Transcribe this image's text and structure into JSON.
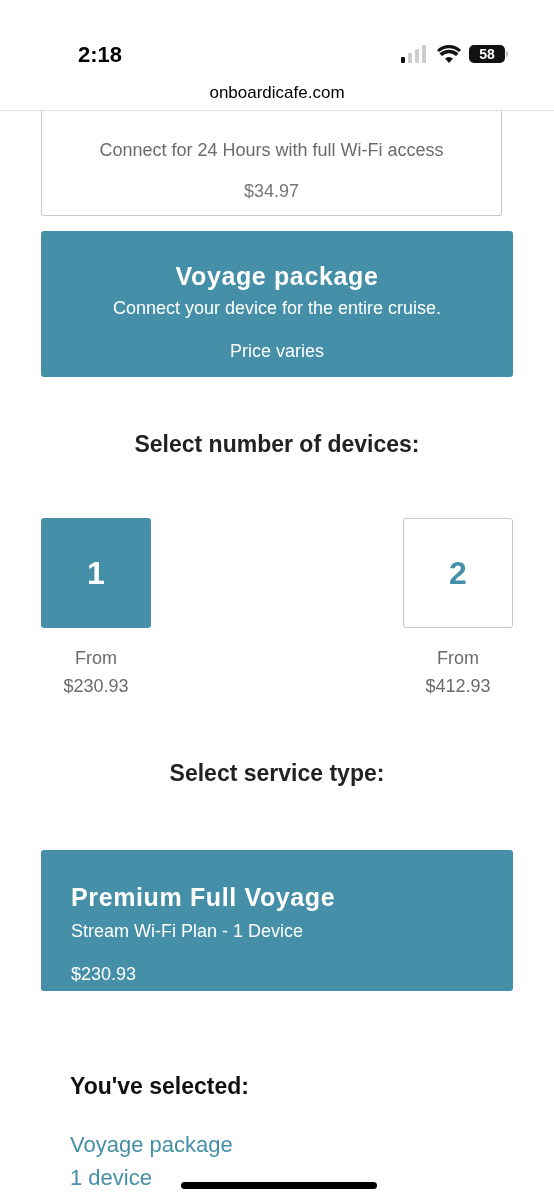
{
  "status_bar": {
    "time": "2:18",
    "battery": "58"
  },
  "address_bar": {
    "url": "onboardicafe.com"
  },
  "packages": [
    {
      "description": "Connect for 24 Hours with full Wi-Fi access",
      "price": "$34.97",
      "selected": false
    },
    {
      "title": "Voyage package",
      "description": "Connect your device for the entire cruise.",
      "price": "Price varies",
      "selected": true
    }
  ],
  "devices": {
    "heading": "Select number of devices:",
    "options": [
      {
        "label": "1",
        "from": "From",
        "price": "$230.93",
        "selected": true
      },
      {
        "label": "2",
        "from": "From",
        "price": "$412.93",
        "selected": false
      }
    ]
  },
  "service": {
    "heading": "Select service type:",
    "options": [
      {
        "title": "Premium Full Voyage",
        "description": "Stream Wi-Fi Plan - 1 Device",
        "price": "$230.93",
        "selected": true
      }
    ]
  },
  "summary": {
    "heading": "You've selected:",
    "items": [
      "Voyage package",
      "1 device"
    ]
  }
}
